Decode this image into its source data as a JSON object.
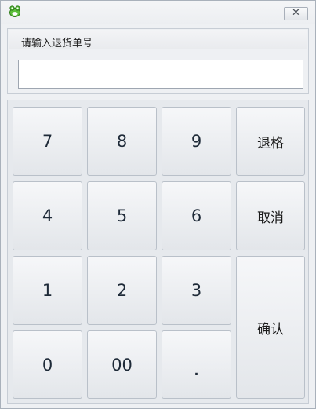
{
  "titlebar": {
    "icon": "frog-app-icon",
    "close_label": "✕"
  },
  "input_panel": {
    "label": "请输入退货单号",
    "value": "",
    "placeholder": ""
  },
  "keypad": {
    "keys": {
      "k7": "7",
      "k8": "8",
      "k9": "9",
      "k4": "4",
      "k5": "5",
      "k6": "6",
      "k1": "1",
      "k2": "2",
      "k3": "3",
      "k0": "0",
      "k00": "00",
      "kdot": "."
    },
    "backspace_label": "退格",
    "cancel_label": "取消",
    "confirm_label": "确认"
  },
  "colors": {
    "window_bg": "#eef0f3",
    "key_text": "#1e2a38",
    "border": "#b9c0c9"
  }
}
